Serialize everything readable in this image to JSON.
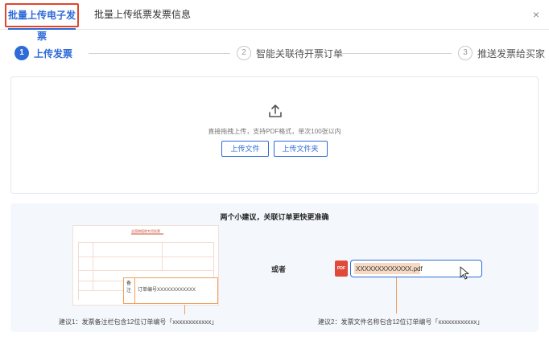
{
  "tabs": {
    "active": "批量上传电子发票",
    "second": "批量上传纸票发票信息",
    "close": "×"
  },
  "steps": [
    {
      "num": "1",
      "label": "上传发票"
    },
    {
      "num": "2",
      "label": "智能关联待开票订单"
    },
    {
      "num": "3",
      "label": "推送发票给买家"
    }
  ],
  "upload": {
    "hint": "直接拖拽上传，支持PDF格式，单次100张以内",
    "upload_file_label": "上传文件",
    "upload_folder_label": "上传文件夹"
  },
  "tips": {
    "title": "两个小建议，关联订单更快更准确",
    "doc_title": "全国增值税专用发票",
    "remark_label": "备注",
    "remark_text": "订单编号XXXXXXXXXXXX",
    "or": "或者",
    "pdf_badge": "PDF",
    "file_name": "XXXXXXXXXXXXX.pdf",
    "tip1": "建议1：发票备注栏包含12位订单编号「xxxxxxxxxxxx」",
    "tip2": "建议2：发票文件名称包含12位订单编号「xxxxxxxxxxxx」"
  },
  "colors": {
    "accent": "#2f6bd8",
    "highlight_border": "#e0452f",
    "callout": "#f0a060",
    "pdf": "#e04a3a"
  }
}
